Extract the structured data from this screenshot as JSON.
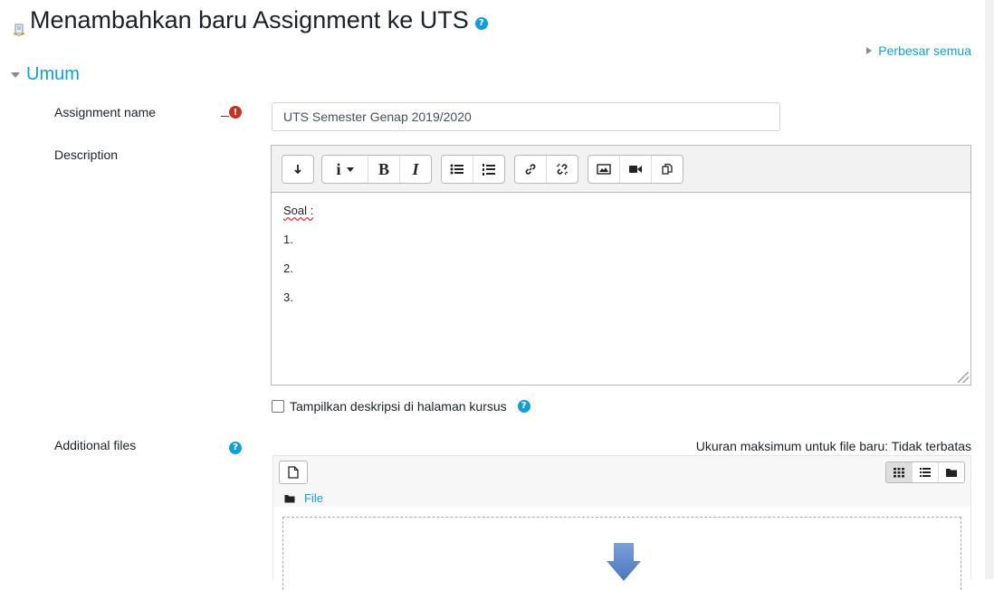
{
  "page": {
    "title": "Menambahkan baru Assignment ke UTS",
    "expand_all": "Perbesar semua"
  },
  "section": {
    "title": "Umum"
  },
  "fields": {
    "assignment_name": {
      "label": "Assignment name",
      "value": "UTS Semester Genap 2019/2020"
    },
    "description": {
      "label": "Description",
      "content": [
        "Soal :",
        "1.",
        "2.",
        "3."
      ],
      "show_in_course_label": "Tampilkan deskripsi di halaman kursus",
      "show_in_course_checked": false
    },
    "additional_files": {
      "label": "Additional files",
      "max_size_text": "Ukuran maksimum untuk file baru: Tidak terbatas",
      "path_folder": "File"
    }
  },
  "icons": {
    "required": "!",
    "help": "?"
  },
  "colors": {
    "link": "#0f9fd8",
    "required": "#ca3120",
    "text": "#1d2125"
  }
}
